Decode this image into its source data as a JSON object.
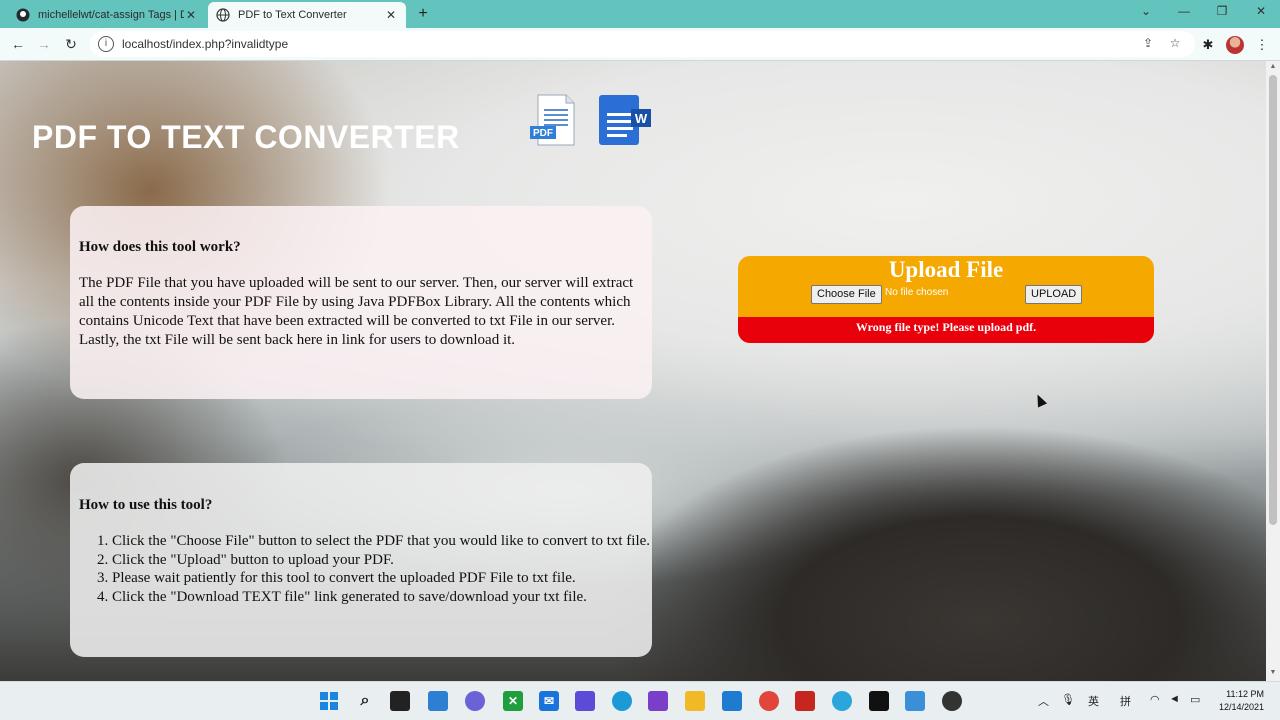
{
  "browser": {
    "tabs": [
      {
        "title": "michellelwt/cat-assign Tags | Do",
        "active": false,
        "favicon": "github-icon"
      },
      {
        "title": "PDF to Text Converter",
        "active": true,
        "favicon": "globe-icon"
      }
    ],
    "url": "localhost/index.php?invalidtype"
  },
  "page": {
    "heading": "PDF TO TEXT CONVERTER",
    "pdf_icon_label": "PDF",
    "word_icon_label": "W",
    "how_it_works": {
      "title": "How does this tool work?",
      "body": "The PDF File that you have uploaded will be sent to our server. Then, our server will extract all the contents inside your PDF File by using Java PDFBox Library. All the contents which contains Unicode Text that have been extracted will be converted to txt File in our server. Lastly, the txt File will be sent back here in link for users to download it."
    },
    "how_to_use": {
      "title": "How to use this tool?",
      "steps": [
        "Click the \"Choose File\" button to select the PDF that you would like to convert to txt file.",
        "Click the \"Upload\" button to upload your PDF.",
        "Please wait patiently for this tool to convert the uploaded PDF File to txt file.",
        "Click the \"Download TEXT file\" link generated to save/download your txt file."
      ]
    },
    "upload": {
      "title": "Upload File",
      "choose_label": "Choose File",
      "no_file": "No file chosen",
      "upload_label": "UPLOAD",
      "error": "Wrong file type! Please upload pdf."
    }
  },
  "taskbar": {
    "time": "11:12 PM",
    "date": "12/14/2021",
    "ime": [
      "英",
      "拼"
    ]
  },
  "colors": {
    "tabbar": "#63c3bd",
    "upload_orange": "#f5a800",
    "error_red": "#e8000b"
  }
}
